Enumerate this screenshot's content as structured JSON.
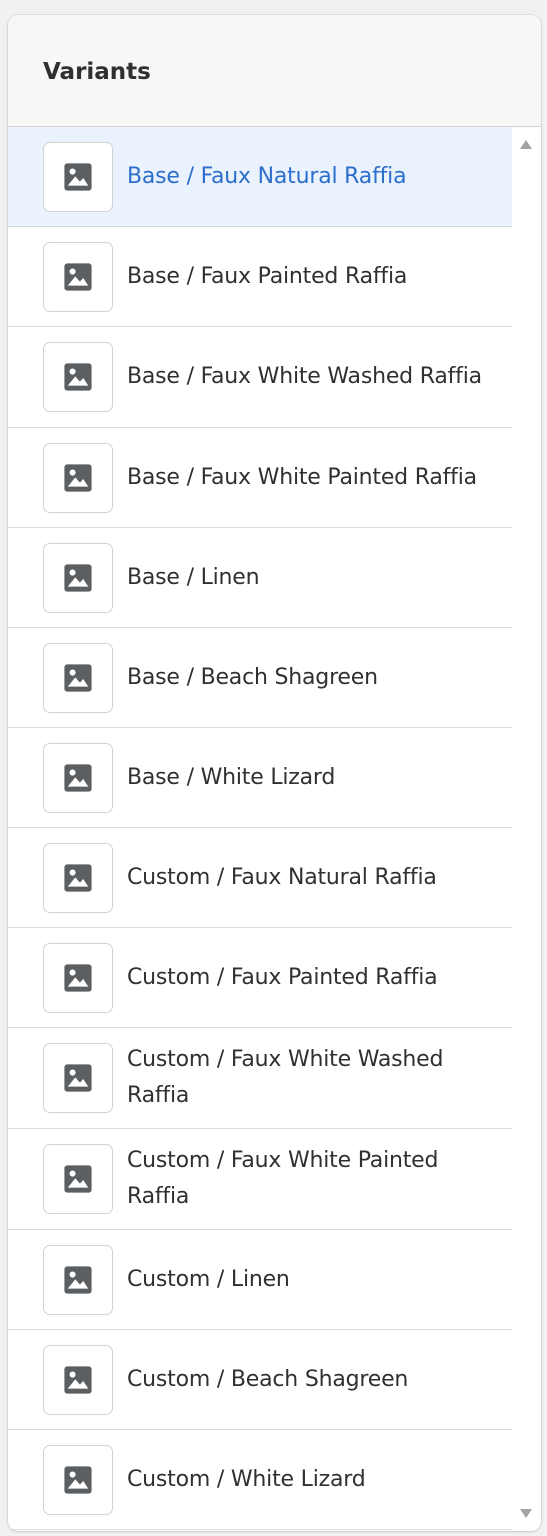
{
  "panel": {
    "title": "Variants"
  },
  "variants": [
    {
      "label": "Base / Faux Natural Raffia",
      "selected": true
    },
    {
      "label": "Base / Faux Painted Raffia",
      "selected": false
    },
    {
      "label": "Base / Faux White Washed Raffia",
      "selected": false
    },
    {
      "label": "Base / Faux White Painted Raffia",
      "selected": false
    },
    {
      "label": "Base / Linen",
      "selected": false
    },
    {
      "label": "Base / Beach Shagreen",
      "selected": false
    },
    {
      "label": "Base / White Lizard",
      "selected": false
    },
    {
      "label": "Custom / Faux Natural Raffia",
      "selected": false
    },
    {
      "label": "Custom / Faux Painted Raffia",
      "selected": false
    },
    {
      "label": "Custom / Faux White Washed Raffia",
      "selected": false
    },
    {
      "label": "Custom / Faux White Painted Raffia",
      "selected": false
    },
    {
      "label": "Custom / Linen",
      "selected": false
    },
    {
      "label": "Custom / Beach Shagreen",
      "selected": false
    },
    {
      "label": "Custom / White Lizard",
      "selected": false
    }
  ],
  "thumbnail_icon": "image-placeholder-icon",
  "colors": {
    "selected_text": "#2c6ecb",
    "selected_background": "#eaf3fd",
    "icon": "#5c5f62"
  }
}
